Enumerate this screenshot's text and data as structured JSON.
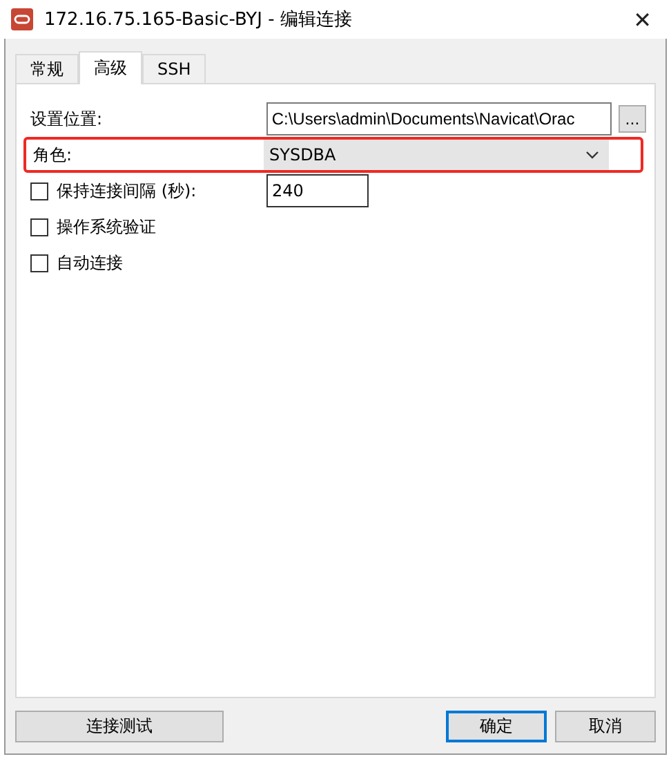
{
  "window": {
    "title": "172.16.75.165-Basic-BYJ - 编辑连接",
    "close": "✕"
  },
  "tabs": [
    {
      "label": "常规",
      "selected": false
    },
    {
      "label": "高级",
      "selected": true
    },
    {
      "label": "SSH",
      "selected": false
    }
  ],
  "settings_location": {
    "label": "设置位置:",
    "value": "C:\\Users\\admin\\Documents\\Navicat\\Orac",
    "browse": "..."
  },
  "role": {
    "label": "角色:",
    "value": "SYSDBA",
    "highlighted": true
  },
  "options": [
    {
      "label": "保持连接间隔 (秒):",
      "checked": false,
      "value": "240"
    },
    {
      "label": "操作系统验证",
      "checked": false
    },
    {
      "label": "自动连接",
      "checked": false
    }
  ],
  "buttons": {
    "test": "连接测试",
    "ok": "确定",
    "cancel": "取消"
  }
}
